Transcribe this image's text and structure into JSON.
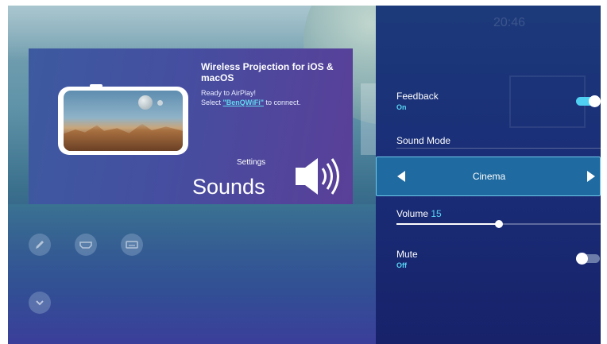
{
  "hero": {
    "title": "Wireless Projection for iOS & macOS",
    "subtitle_line1": "Ready to AirPlay!",
    "subtitle_prefix": "Select ",
    "network_name": "\"BenQWiFi\"",
    "subtitle_suffix": " to connect.",
    "category": "Settings",
    "name": "Sounds"
  },
  "status": {
    "clock": "20:46"
  },
  "apps": [
    {
      "icon": "pencil-icon"
    },
    {
      "icon": "hdmi-icon"
    },
    {
      "icon": "keyboard-icon"
    },
    {
      "icon": "chevron-down-icon"
    }
  ],
  "settings": {
    "feedback": {
      "label": "Feedback",
      "value": "On",
      "enabled": true
    },
    "sound_mode": {
      "label": "Sound Mode",
      "value": "Cinema"
    },
    "volume": {
      "label": "Volume",
      "value": "15",
      "level_fraction": 0.5
    },
    "mute": {
      "label": "Mute",
      "value": "Off",
      "enabled": false
    }
  },
  "colors": {
    "accent": "#59d5f5",
    "panel": "#1a2e78",
    "toggle_on": "#4fd0f2",
    "toggle_off": "#6b7da8",
    "link": "#61d7f0"
  }
}
